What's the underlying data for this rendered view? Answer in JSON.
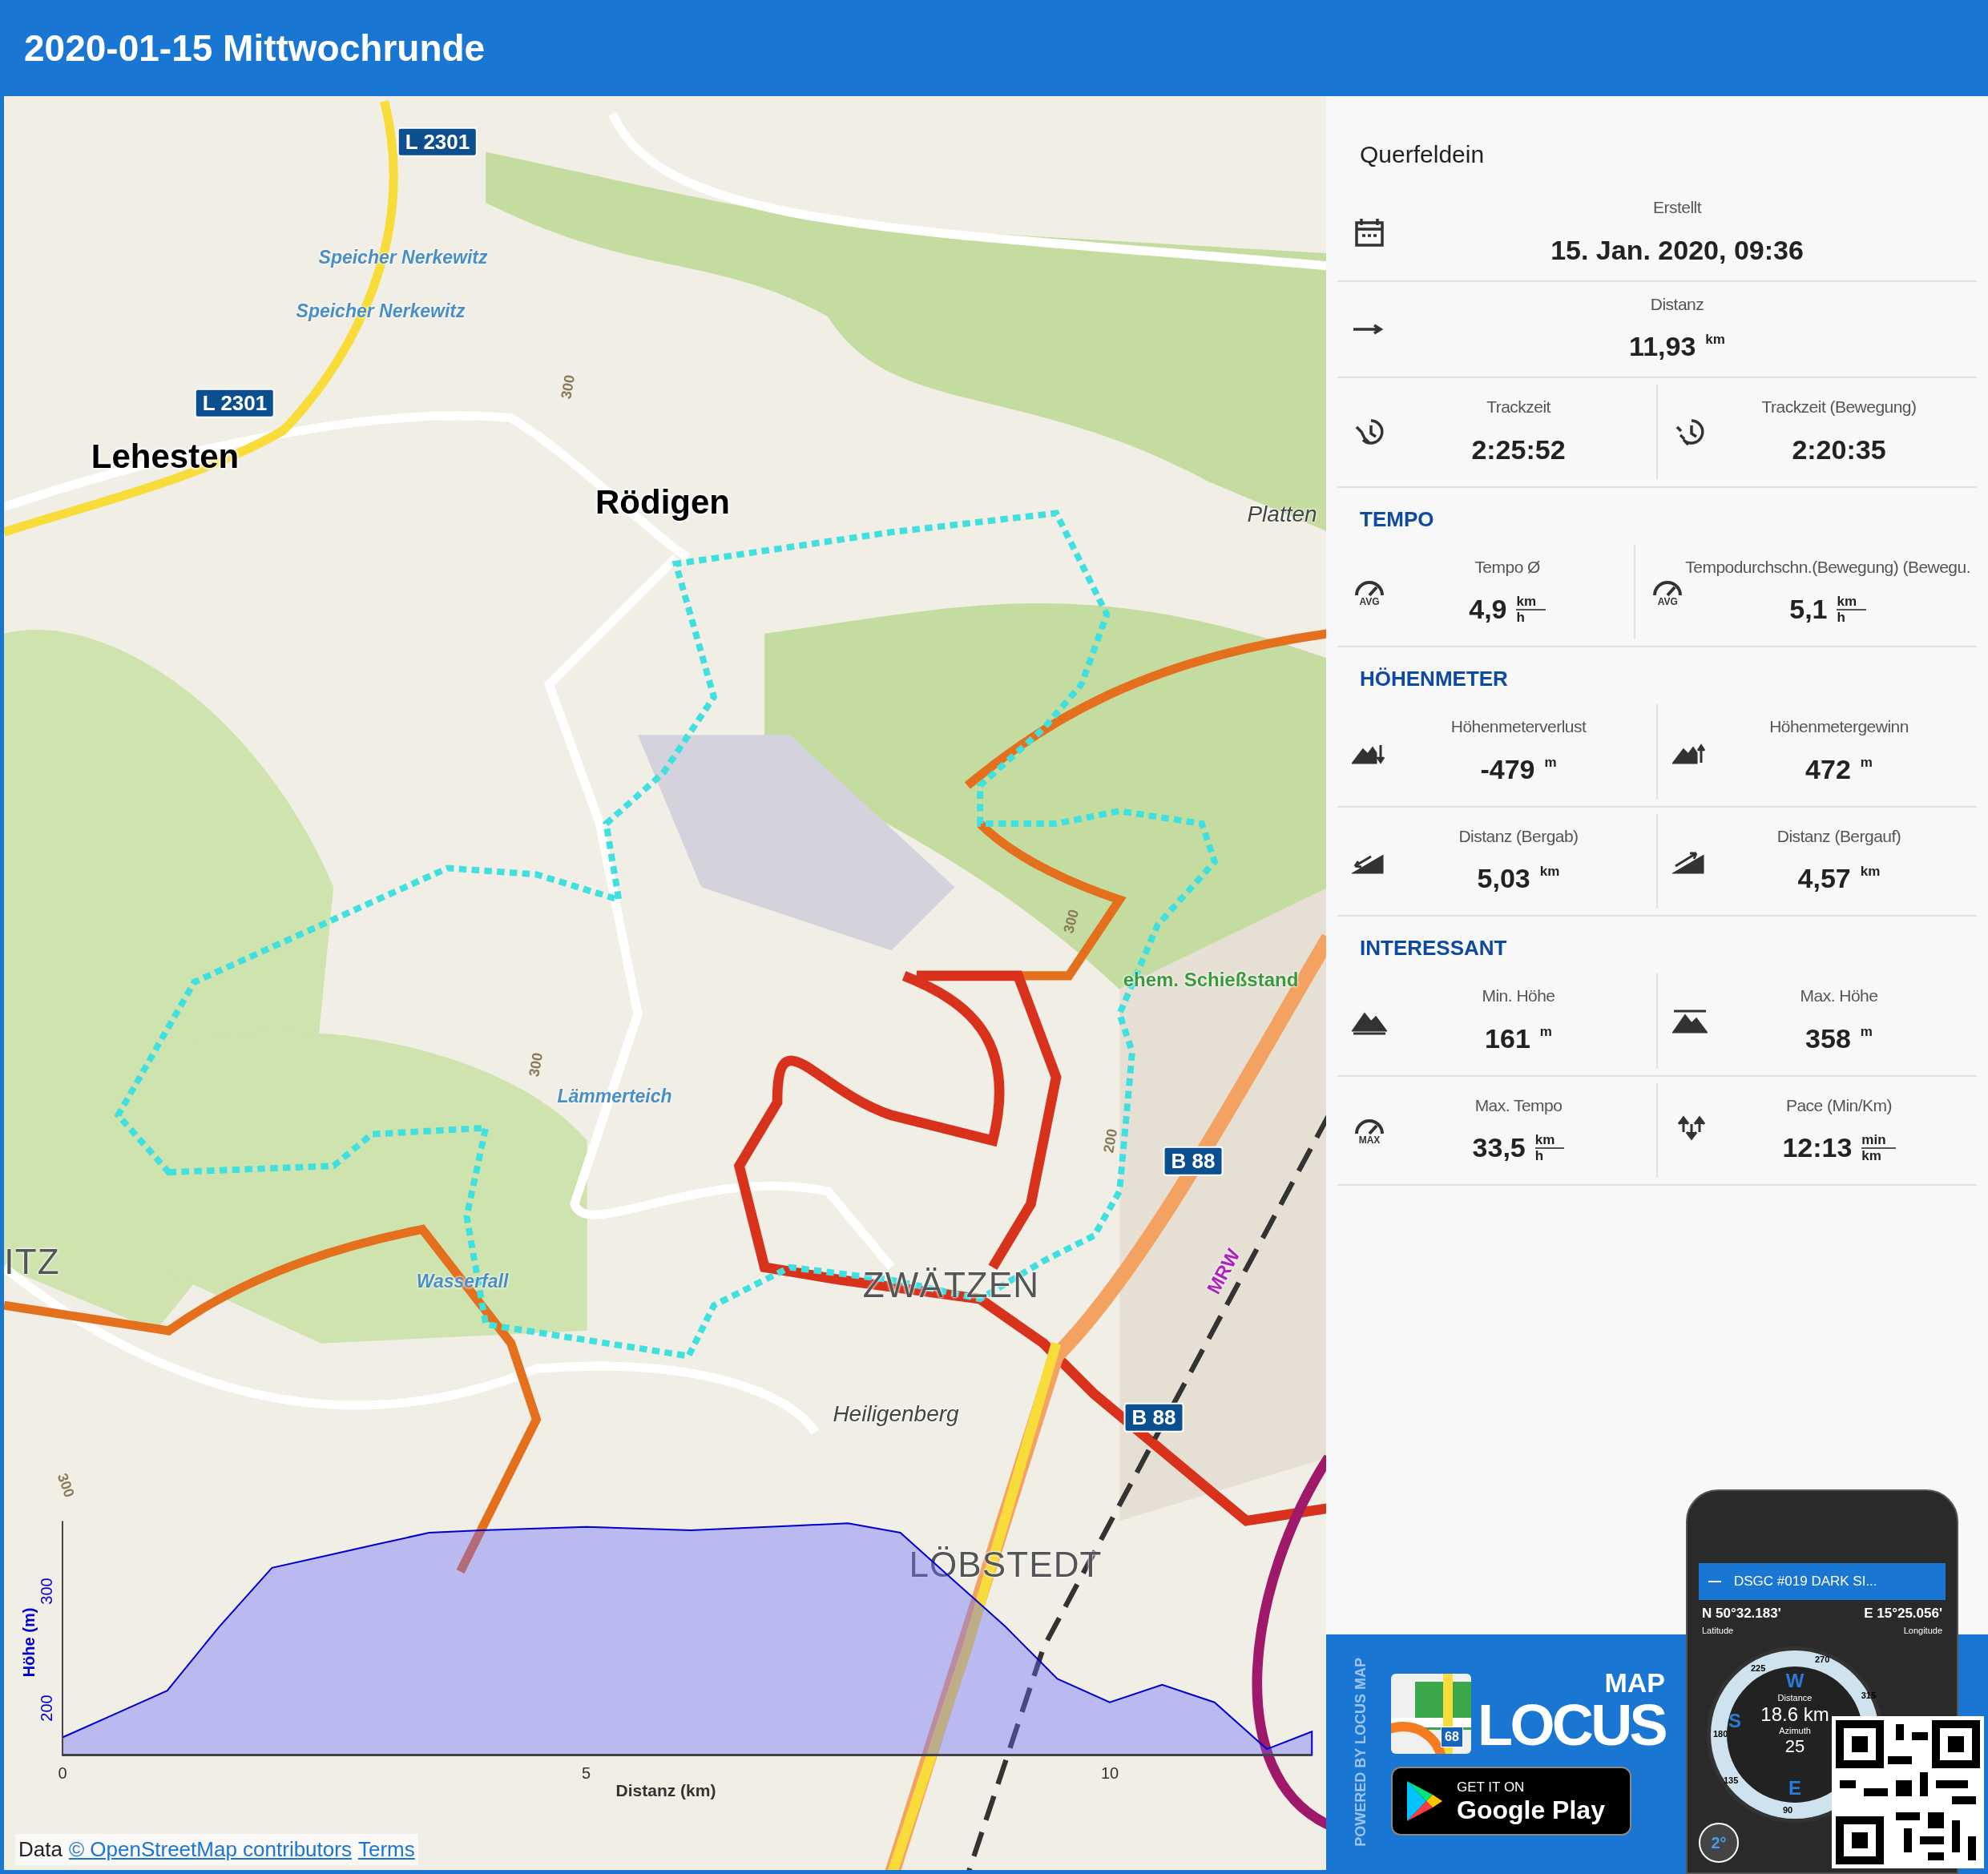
{
  "header": {
    "title": "2020-01-15 Mittwochrunde"
  },
  "map": {
    "labels": [
      {
        "text": "L 2301",
        "kind": "shield"
      },
      {
        "text": "Speicher Nerkewitz",
        "kind": "water"
      },
      {
        "text": "Speicher Nerkewitz",
        "kind": "water"
      },
      {
        "text": "L 2301",
        "kind": "shield"
      },
      {
        "text": "Lehesten",
        "kind": "town"
      },
      {
        "text": "Rödigen",
        "kind": "town"
      },
      {
        "text": "Platten",
        "kind": "place"
      },
      {
        "text": "300",
        "kind": "contour"
      },
      {
        "text": "300",
        "kind": "contour"
      },
      {
        "text": "ehem. Schießstand",
        "kind": "poi"
      },
      {
        "text": "Lämmerteich",
        "kind": "water"
      },
      {
        "text": "B 88",
        "kind": "shield"
      },
      {
        "text": "ITZ",
        "kind": "district"
      },
      {
        "text": "Wasserfall",
        "kind": "water"
      },
      {
        "text": "ZWÄTZEN",
        "kind": "district"
      },
      {
        "text": "MRW",
        "kind": "route"
      },
      {
        "text": "B 88",
        "kind": "shield"
      },
      {
        "text": "Heiligenberg",
        "kind": "place"
      },
      {
        "text": "LÖBSTEDT",
        "kind": "district"
      },
      {
        "text": "300",
        "kind": "contour"
      },
      {
        "text": "200",
        "kind": "contour"
      },
      {
        "text": "300",
        "kind": "contour"
      }
    ],
    "chart_data": {
      "type": "area",
      "xlabel": "Distanz (km)",
      "ylabel": "Höhe (m)",
      "x": [
        0,
        0.5,
        1,
        1.5,
        2,
        2.5,
        3,
        3.5,
        4,
        5,
        6,
        7,
        7.5,
        8,
        8.5,
        9,
        9.5,
        10,
        10.5,
        11,
        11.5,
        11.93
      ],
      "series": [
        {
          "color": "#0000cc",
          "values": [
            175,
            195,
            215,
            270,
            320,
            330,
            340,
            350,
            352,
            355,
            352,
            356,
            358,
            350,
            310,
            270,
            225,
            205,
            220,
            205,
            165,
            180
          ]
        }
      ],
      "xlim": [
        0,
        11.93
      ],
      "ylim": [
        160,
        360
      ],
      "xticks": [
        0,
        5,
        10
      ],
      "yticks": [
        200,
        300
      ]
    },
    "attribution": {
      "prefix": "Data",
      "links": [
        "© OpenStreetMap contributors",
        "Terms"
      ]
    }
  },
  "panel": {
    "activity": "Querfeldein",
    "sections": [
      {
        "rows": [
          [
            {
              "label": "Erstellt",
              "value": "15. Jan. 2020, 09:36"
            }
          ]
        ]
      },
      {
        "rows": [
          [
            {
              "label": "Distanz",
              "value": "11,93",
              "unit": "km"
            }
          ]
        ]
      },
      {
        "rows": [
          [
            {
              "label": "Trackzeit",
              "value": "2:25:52"
            },
            {
              "label": "Trackzeit (Bewegung)",
              "value": "2:20:35"
            }
          ]
        ]
      },
      {
        "heading": "TEMPO",
        "rows": [
          [
            {
              "label": "Tempo Ø",
              "value": "4,9",
              "unit": "km",
              "per": "h",
              "badge": "AVG"
            },
            {
              "label": "Tempodurchschn.(Bewegung) (Bewegu.",
              "value": "5,1",
              "unit": "km",
              "per": "h",
              "badge": "AVG"
            }
          ]
        ]
      },
      {
        "heading": "HÖHENMETER",
        "rows": [
          [
            {
              "label": "Höhenmeterverlust",
              "value": "-479",
              "unit": "m"
            },
            {
              "label": "Höhenmetergewinn",
              "value": "472",
              "unit": "m"
            }
          ],
          [
            {
              "label": "Distanz (Bergab)",
              "value": "5,03",
              "unit": "km"
            },
            {
              "label": "Distanz (Bergauf)",
              "value": "4,57",
              "unit": "km"
            }
          ]
        ]
      },
      {
        "heading": "INTERESSANT",
        "rows": [
          [
            {
              "label": "Min. Höhe",
              "value": "161",
              "unit": "m"
            },
            {
              "label": "Max. Höhe",
              "value": "358",
              "unit": "m"
            }
          ],
          [
            {
              "label": "Max. Tempo",
              "value": "33,5",
              "unit": "km",
              "per": "h",
              "badge": "MAX"
            },
            {
              "label": "Pace (Min/Km)",
              "value": "12:13",
              "unit": "min",
              "per": "km"
            }
          ]
        ]
      }
    ]
  },
  "promo": {
    "powered": "POWERED BY LOCUS MAP",
    "logo_small": "MAP",
    "logo_big": "LOCUS",
    "logo_badge": "68",
    "store_top": "GET IT ON",
    "store_name": "Google Play",
    "phone": {
      "title": "DSGC #019 DARK SI...",
      "lat": "N 50°32.183'",
      "lat_label": "Latitude",
      "lon": "E 15°25.056'",
      "lon_label": "Longitude",
      "distance_label": "Distance",
      "distance": "18.6 km",
      "azimuth_label": "Azimuth",
      "azimuth": "25",
      "dial": [
        "270",
        "225",
        "315",
        "180",
        "135",
        "90"
      ],
      "west": "W",
      "south": "S",
      "east": "E",
      "tilt": "2°"
    }
  }
}
